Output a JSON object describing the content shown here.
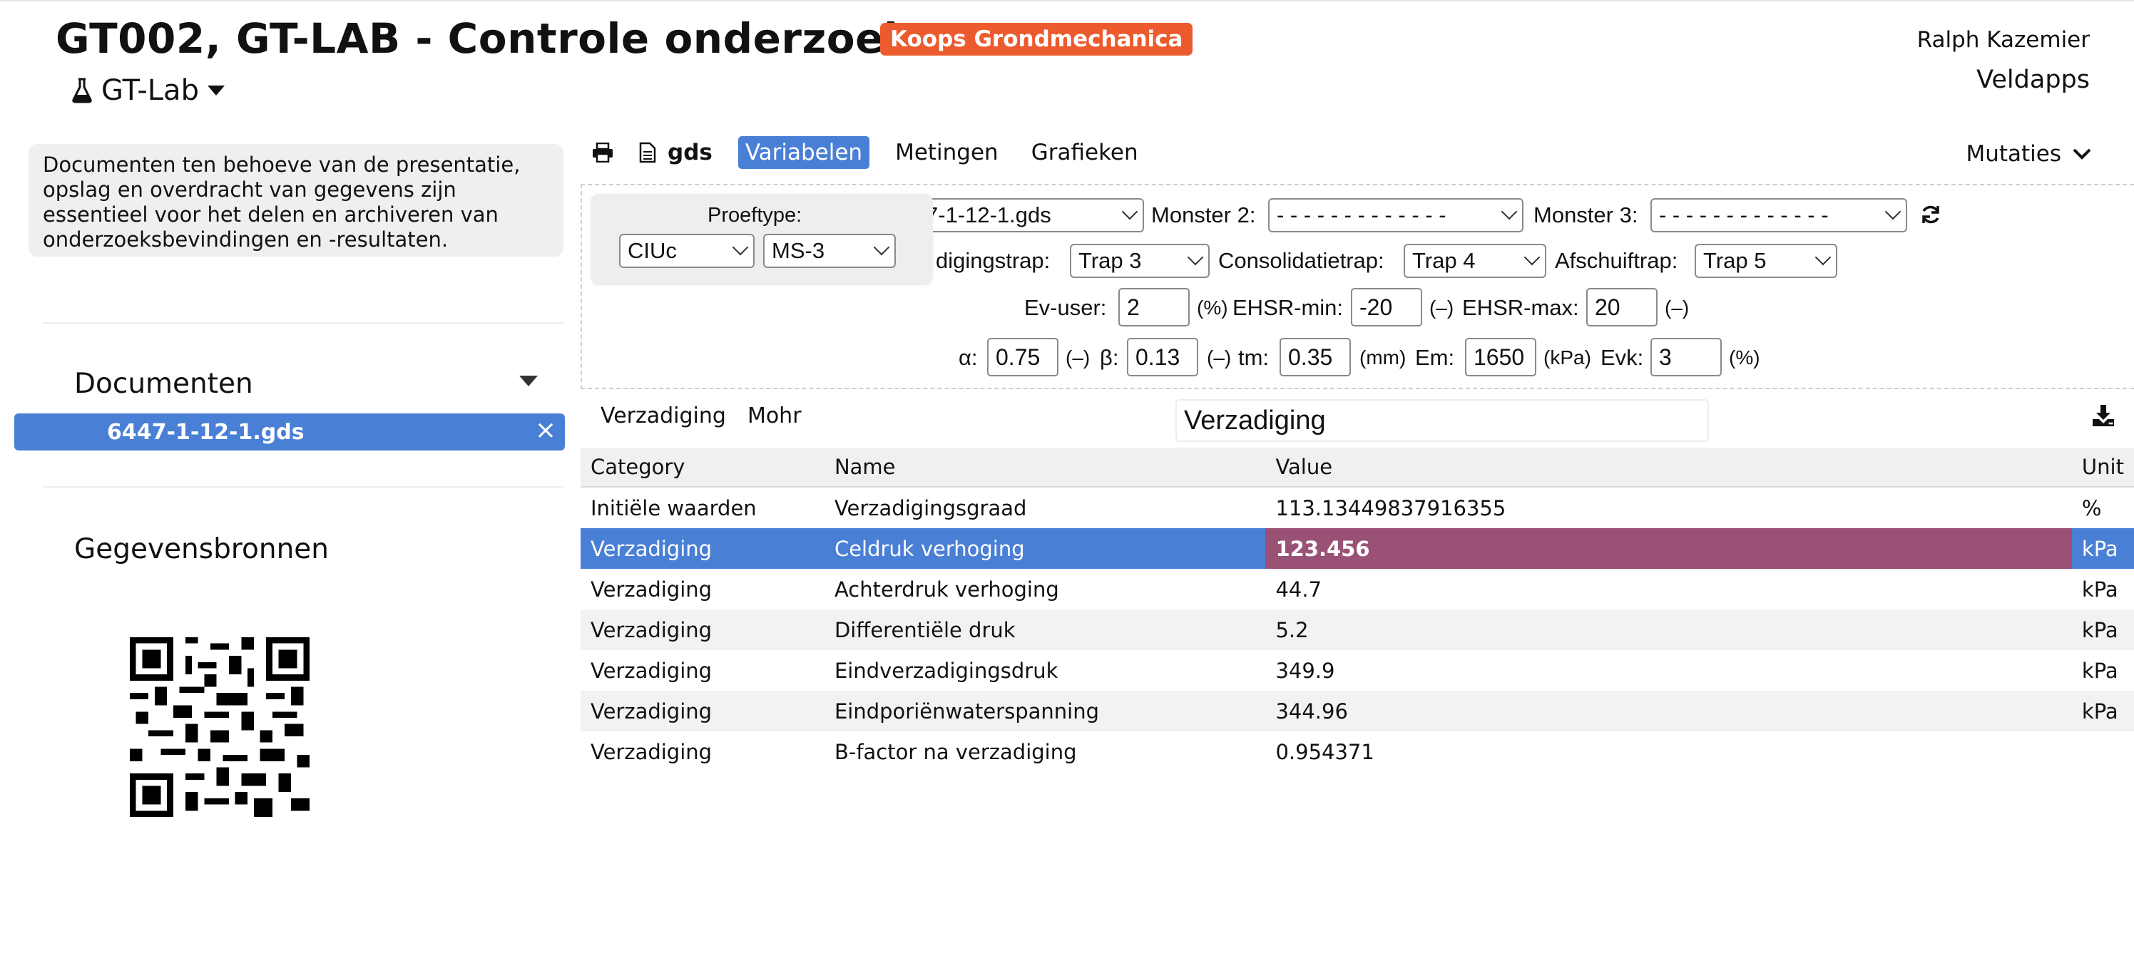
{
  "header": {
    "title": "GT002, GT-LAB - Controle onderzoek",
    "badge": "Koops Grondmechanica",
    "app_menu_label": "GT-Lab",
    "user_name": "Ralph Kazemier",
    "organization": "Veldapps"
  },
  "sidebar": {
    "info_text": "Documenten ten behoeve van de presentatie, opslag en overdracht van gegevens zijn essentieel voor het delen en archiveren van onderzoeksbevindingen en -resultaten.",
    "documents_header": "Documenten",
    "documents": [
      {
        "name": "6447-1-12-1.gds",
        "remove": "×"
      }
    ],
    "sources_header": "Gegevensbronnen"
  },
  "toolbar": {
    "file_label": "gds",
    "tabs": [
      "Variabelen",
      "Metingen",
      "Grafieken"
    ],
    "active_tab": "Variabelen",
    "mutaties_label": "Mutaties"
  },
  "form": {
    "proeftype_label": "Proeftype:",
    "proeftype_value": "CIUc",
    "ms_value": "MS-3",
    "monster1_value": "7-1-12-1.gds",
    "monster2_label": "Monster 2:",
    "monster2_value": "- - - - - - - - - - - - -",
    "monster3_label": "Monster 3:",
    "monster3_value": "- - - - - - - - - - - - -",
    "verzadigingstrap_label": "digingstrap:",
    "verzadigingstrap_value": "Trap 3",
    "consolidatietrap_label": "Consolidatietrap:",
    "consolidatietrap_value": "Trap 4",
    "afschuiftrap_label": "Afschuiftrap:",
    "afschuiftrap_value": "Trap 5",
    "ev_user_label": "Ev-user:",
    "ev_user_value": "2",
    "ev_user_unit": "(%)",
    "ehsr_min_label": "EHSR-min:",
    "ehsr_min_value": "-20",
    "ehsr_min_unit": "(–)",
    "ehsr_max_label": "EHSR-max:",
    "ehsr_max_value": "20",
    "ehsr_max_unit": "(–)",
    "alpha_label": "α:",
    "alpha_value": "0.75",
    "alpha_unit": "(–)",
    "beta_label": "β:",
    "beta_value": "0.13",
    "beta_unit": "(–)",
    "tm_label": "tm:",
    "tm_value": "0.35",
    "tm_unit": "(mm)",
    "em_label": "Em:",
    "em_value": "1650",
    "em_unit": "(kPa)",
    "evk_label": "Evk:",
    "evk_value": "3",
    "evk_unit": "(%)"
  },
  "results": {
    "tabs": [
      "Verzadiging",
      "Mohr"
    ],
    "title": "Verzadiging",
    "columns": [
      "Category",
      "Name",
      "Value",
      "Unit"
    ],
    "rows": [
      {
        "category": "Initiële waarden",
        "name": "Verzadigingsgraad",
        "value": "113.13449837916355",
        "unit": "%"
      },
      {
        "category": "Verzadiging",
        "name": "Celdruk verhoging",
        "value": "123.456",
        "unit": "kPa"
      },
      {
        "category": "Verzadiging",
        "name": "Achterdruk verhoging",
        "value": "44.7",
        "unit": "kPa"
      },
      {
        "category": "Verzadiging",
        "name": "Differentiële druk",
        "value": "5.2",
        "unit": "kPa"
      },
      {
        "category": "Verzadiging",
        "name": "Eindverzadigingsdruk",
        "value": "349.9",
        "unit": "kPa"
      },
      {
        "category": "Verzadiging",
        "name": "Eindporiënwaterspanning",
        "value": "344.96",
        "unit": "kPa"
      },
      {
        "category": "Verzadiging",
        "name": "B-factor na verzadiging",
        "value": "0.954371",
        "unit": ""
      }
    ]
  },
  "colors": {
    "accent": "#4a7fd6",
    "badge": "#ec5b2e",
    "selected_value": "#995276"
  }
}
